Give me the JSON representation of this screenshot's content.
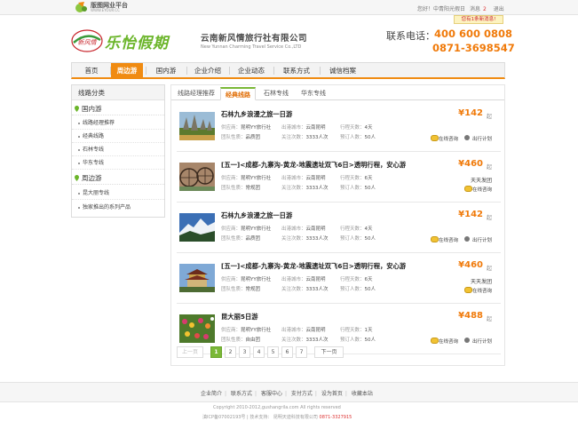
{
  "topbar": {
    "platform_name": "版图网业平台",
    "platform_url": "WWW.EYOUR.CC",
    "welcome": "您好！中青阳光假日",
    "messages_label": "消息",
    "messages_count": "2",
    "logout": "退出",
    "notice": "您有1条新消息!"
  },
  "header": {
    "brand_title": "乐怡假期",
    "logo_text": "新风情",
    "company_cn": "云南新风情旅行社有限公司",
    "company_en": "New Yunnan Charming Travel Service Co.,LTD",
    "tel_label": "联系电话：",
    "tel_1": "400 600 0808",
    "tel_2": "0871-3698547"
  },
  "nav": {
    "items": [
      {
        "label": "首页"
      },
      {
        "label": "周边游"
      },
      {
        "label": "国内游"
      },
      {
        "label": "企业介绍"
      },
      {
        "label": "企业动态"
      },
      {
        "label": "联系方式"
      },
      {
        "label": "诚信档案"
      }
    ],
    "active_index": 1
  },
  "sidebar": {
    "title": "线路分类",
    "categories": [
      {
        "label": "国内游",
        "items": [
          {
            "label": "线路经理推荐"
          },
          {
            "label": "经典线路"
          },
          {
            "label": "石林专线"
          },
          {
            "label": "华东专线"
          }
        ]
      },
      {
        "label": "周边游",
        "items": [
          {
            "label": "昆大丽专线"
          },
          {
            "label": "独家推出的系列产品"
          }
        ]
      }
    ]
  },
  "tabs": {
    "items": [
      {
        "label": "线路经理推荐"
      },
      {
        "label": "经典线路"
      },
      {
        "label": "石林专线"
      },
      {
        "label": "华东专线"
      }
    ],
    "active_index": 1
  },
  "labels": {
    "supplier": "供应商：",
    "departure": "出港城市：",
    "duration": "行程天数：",
    "group_type": "团队性质：",
    "attention": "关注次数：",
    "booked": "预订人数：",
    "price_unit": "起",
    "consult": "在线咨询",
    "plan": "出行计划"
  },
  "products": [
    {
      "title": "石林九乡浪漫之旅一日游",
      "supplier": "昆明YY旅行社",
      "departure": "云南昆明",
      "duration": "4天",
      "group_type": "品质团",
      "attention": "3333人次",
      "booked": "50人",
      "price": "¥142",
      "tag": "",
      "thumb": "stone-forest"
    },
    {
      "title": "[五一]<成都-九寨沟-黄龙-地震遗址双飞6日>透明行程，安心游",
      "supplier": "昆明YY旅行社",
      "departure": "云南昆明",
      "duration": "6天",
      "group_type": "常规团",
      "attention": "3333人次",
      "booked": "50人",
      "price": "¥460",
      "tag": "天天发团",
      "thumb": "waterwheel"
    },
    {
      "title": "石林九乡浪漫之旅一日游",
      "supplier": "昆明YY旅行社",
      "departure": "云南昆明",
      "duration": "4天",
      "group_type": "品质团",
      "attention": "3333人次",
      "booked": "50人",
      "price": "¥142",
      "tag": "",
      "thumb": "snow-mountain"
    },
    {
      "title": "[五一]<成都-九寨沟-黄龙-地震遗址双飞6日>透明行程，安心游",
      "supplier": "昆明YY旅行社",
      "departure": "云南昆明",
      "duration": "6天",
      "group_type": "常规团",
      "attention": "3333人次",
      "booked": "50人",
      "price": "¥460",
      "tag": "天天发团",
      "thumb": "temple"
    },
    {
      "title": "昆大丽5日游",
      "supplier": "昆明YY旅行社",
      "departure": "云南昆明",
      "duration": "1天",
      "group_type": "自由团",
      "attention": "3333人次",
      "booked": "50人",
      "price": "¥488",
      "tag": "",
      "thumb": "flowers"
    }
  ],
  "pager": {
    "prev": "上一页",
    "pages": [
      "1",
      "2",
      "3",
      "4",
      "5",
      "6",
      "7"
    ],
    "current": "1",
    "next": "下一页"
  },
  "footer": {
    "links": [
      "企业简介",
      "联系方式",
      "客服中心",
      "支付方式",
      "设为首页",
      "收藏本站"
    ],
    "copyright": "Copyright 2010-2012,gushangrila.com All rights reserved",
    "icp": "滇ICP备07002193号",
    "support_label": "技术支持：",
    "support_company": "昆明天迹科技有限公司",
    "support_phone": "0871-3327915"
  },
  "colors": {
    "accent_orange": "#f07a0a",
    "accent_green": "#7ab837",
    "brand_green": "#6bb52a"
  }
}
